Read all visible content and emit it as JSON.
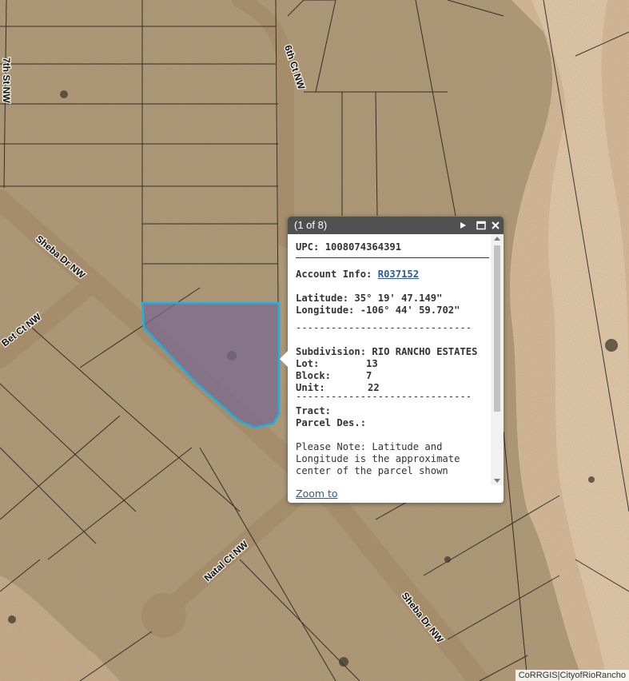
{
  "map": {
    "streets": [
      {
        "name": "6th Ct NW"
      },
      {
        "name": "7th St NW"
      },
      {
        "name": "Sheba Dr NW"
      },
      {
        "name": "Sheba Dr NW"
      },
      {
        "name": "Natal Ct NW"
      },
      {
        "name": "Bet Ct NW"
      }
    ],
    "highlight_color": "#1ab2e6",
    "fill_color": "#7a6a8f"
  },
  "popup": {
    "title": "(1 of 8)",
    "upc_label": "UPC:",
    "upc_value": "1008074364391",
    "account_label": "Account Info:",
    "account_value": "R037152",
    "latitude_label": "Latitude:",
    "latitude_value": "35° 19' 47.149\"",
    "longitude_label": "Longitude:",
    "longitude_value": "-106° 44' 59.702\"",
    "separator1": "------------------------------",
    "subdivision_label": "Subdivision:",
    "subdivision_value": "RIO RANCHO ESTATES",
    "lot_label": "Lot:",
    "lot_value": "13",
    "block_label": "Block:",
    "block_value": "7",
    "unit_label": "Unit:",
    "unit_value": "22",
    "separator2": "------------------------------",
    "tract_label": "Tract:",
    "parcel_label": "Parcel Des.:",
    "note": "Please Note: Latitude and Longitude is the approximate center of the parcel shown",
    "zoom_label": "Zoom to"
  },
  "attribution": "CoRRGIS|CityofRioRancho"
}
